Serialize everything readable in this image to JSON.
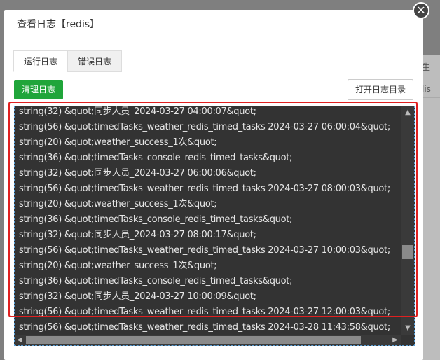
{
  "background": {
    "cells": [
      "生",
      "lis"
    ]
  },
  "modal": {
    "title": "查看日志【redis】"
  },
  "close": {
    "glyph": "✕"
  },
  "tabs": [
    {
      "label": "运行日志"
    },
    {
      "label": "错误日志"
    }
  ],
  "buttons": {
    "clear": "清理日志",
    "open_dir": "打开日志目录"
  },
  "scroll_arrows": {
    "up": "▲",
    "down": "▼",
    "left": "◀",
    "right": "▶"
  },
  "log": [
    "string(32) &quot;同步人员_2024-03-27 04:00:07&quot;",
    "string(56) &quot;timedTasks_weather_redis_timed_tasks 2024-03-27 06:00:04&quot;",
    "string(20) &quot;weather_success_1次&quot;",
    "string(36) &quot;timedTasks_console_redis_timed_tasks&quot;",
    "string(32) &quot;同步人员_2024-03-27 06:00:06&quot;",
    "string(56) &quot;timedTasks_weather_redis_timed_tasks 2024-03-27 08:00:03&quot;",
    "string(20) &quot;weather_success_1次&quot;",
    "string(36) &quot;timedTasks_console_redis_timed_tasks&quot;",
    "string(32) &quot;同步人员_2024-03-27 08:00:17&quot;",
    "string(56) &quot;timedTasks_weather_redis_timed_tasks 2024-03-27 10:00:03&quot;",
    "string(20) &quot;weather_success_1次&quot;",
    "string(36) &quot;timedTasks_console_redis_timed_tasks&quot;",
    "string(32) &quot;同步人员_2024-03-27 10:00:09&quot;",
    "string(56) &quot;timedTasks_weather_redis_timed_tasks 2024-03-27 12:00:03&quot;",
    "string(56) &quot;timedTasks_weather_redis_timed_tasks 2024-03-28 11:43:58&quot;"
  ],
  "colors": {
    "accent_green": "#20a53a",
    "highlight_red": "#e02020",
    "log_bg": "#333333"
  }
}
